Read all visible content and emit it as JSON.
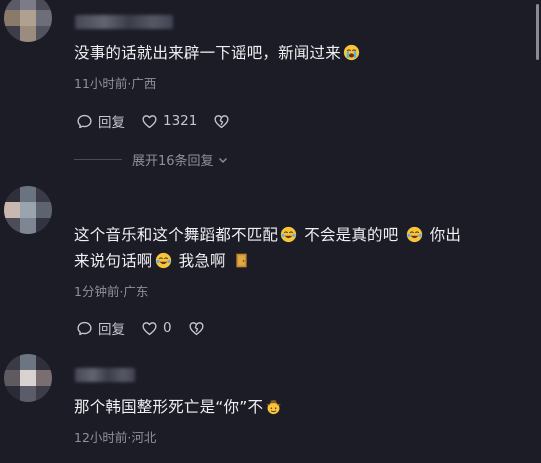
{
  "comments": [
    {
      "text": "没事的话就出来辟一下谣吧，新闻过来",
      "meta": "11小时前·广西",
      "reply_label": "回复",
      "like_count": "1321"
    },
    {
      "text_part1": "这个音乐和这个舞蹈都不匹配",
      "text_part2": "不会是真的吧",
      "text_part3": "你出",
      "text_line2a": "来说句话啊",
      "text_line2b": "我急啊",
      "meta": "1分钟前·广东",
      "reply_label": "回复",
      "like_count": "0"
    },
    {
      "text": "那个韩国整形死亡是“你”不",
      "meta": "12小时前·河北"
    }
  ],
  "expand_replies_label": "展开16条回复",
  "icons": {
    "reply": "comment-bubble-icon",
    "like": "heart-icon",
    "dislike": "broken-heart-icon",
    "expand": "chevron-down-icon",
    "crying_emoji": "loudly-crying-face-emoji",
    "laughing_emoji": "tears-of-joy-emoji",
    "door_emoji": "door-emoji",
    "cowboy_emoji": "cowboy-hat-emoji"
  },
  "colors": {
    "background": "#1c1c27",
    "text": "#f0f0f2",
    "meta": "#8f909a"
  }
}
